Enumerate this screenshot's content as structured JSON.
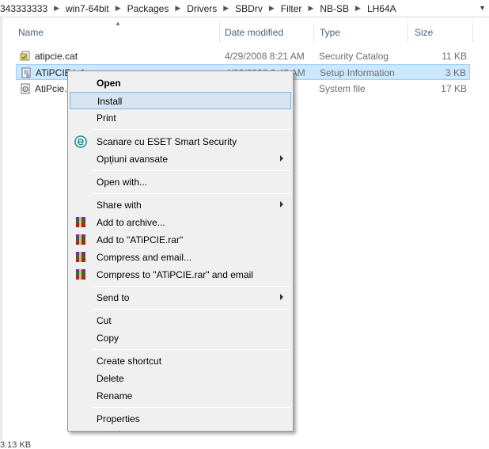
{
  "breadcrumb": {
    "items": [
      "343333333",
      "win7-64bit",
      "Packages",
      "Drivers",
      "SBDrv",
      "Filter",
      "NB-SB",
      "LH64A"
    ]
  },
  "columns": {
    "name": "Name",
    "date": "Date modified",
    "type": "Type",
    "size": "Size"
  },
  "files": [
    {
      "name": "atipcie.cat",
      "date": "4/29/2008 8:21 AM",
      "type": "Security Catalog",
      "size": "11 KB",
      "icon": "security-catalog-icon"
    },
    {
      "name": "ATiPCIE.inf",
      "date": "4/29/2008 3:42 AM",
      "type": "Setup Information",
      "size": "3 KB",
      "icon": "setup-information-icon"
    },
    {
      "name": "AtiPcie.sys",
      "date": "",
      "type": "System file",
      "size": "17 KB",
      "icon": "system-file-icon"
    }
  ],
  "menu": {
    "open": "Open",
    "install": "Install",
    "print": "Print",
    "eset_scan": "Scanare cu ESET Smart Security",
    "advanced": "Opțiuni avansate",
    "open_with": "Open with...",
    "share_with": "Share with",
    "add_archive": "Add to archive...",
    "add_rar": "Add to \"ATiPCIE.rar\"",
    "compress_email": "Compress and email...",
    "compress_rar_email": "Compress to \"ATiPCIE.rar\" and email",
    "send_to": "Send to",
    "cut": "Cut",
    "copy": "Copy",
    "create_shortcut": "Create shortcut",
    "delete": "Delete",
    "rename": "Rename",
    "properties": "Properties"
  },
  "status": {
    "text": "3.13 KB"
  },
  "colors": {
    "selection": "#cce8ff",
    "menu_highlight": "#d5e4f2",
    "eset": "#0d8b93",
    "header_text": "#4c607a"
  }
}
